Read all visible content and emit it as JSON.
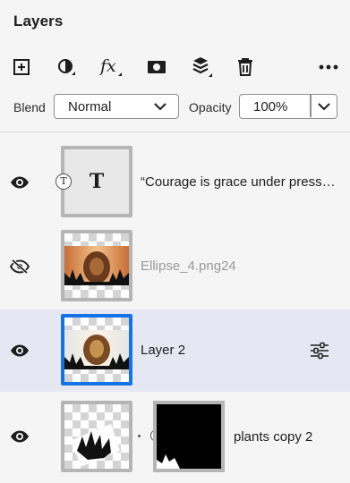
{
  "panel": {
    "title": "Layers"
  },
  "toolbar": {
    "icons": [
      "add-layer-icon",
      "adjustment-icon",
      "fx-icon",
      "mask-icon",
      "layers-stack-icon",
      "trash-icon",
      "more-icon"
    ]
  },
  "blend": {
    "label": "Blend",
    "value": "Normal"
  },
  "opacity": {
    "label": "Opacity",
    "value": "100%"
  },
  "colors": {
    "selected_row": "#e5e8f2",
    "selected_border": "#1473e6",
    "thumb_border": "#b5b5b5"
  },
  "layers": [
    {
      "name": "“Courage is grace under press…",
      "type": "text",
      "visible": true,
      "selected": false
    },
    {
      "name": "Ellipse_4.png24",
      "type": "image",
      "visible": false,
      "selected": false
    },
    {
      "name": "Layer 2",
      "type": "image",
      "visible": true,
      "selected": true
    },
    {
      "name": "plants copy 2",
      "type": "image-with-mask",
      "visible": true,
      "selected": false
    }
  ]
}
